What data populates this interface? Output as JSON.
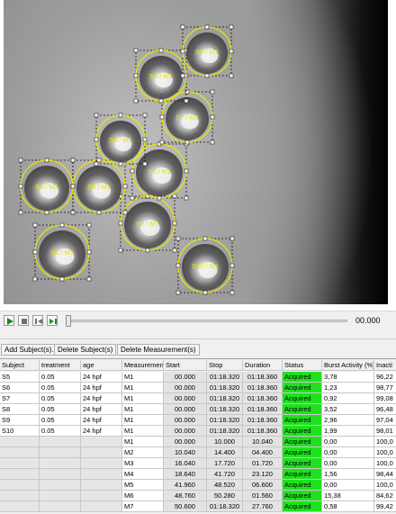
{
  "arena": {
    "regions": [
      {
        "label": "S1 / M1"
      },
      {
        "label": "S2 / M1"
      },
      {
        "label": "S3 / M1"
      },
      {
        "label": "S4 / M1"
      },
      {
        "label": "S5 / M1"
      },
      {
        "label": "S6 / M1"
      },
      {
        "label": "S7 / M1"
      },
      {
        "label": "S8 / M1"
      },
      {
        "label": "S9 / M1"
      },
      {
        "label": "S10 / M1"
      }
    ],
    "region_color": "#e8e800"
  },
  "player": {
    "time": "00.000",
    "progress": 0
  },
  "actions": {
    "add_subjects": "Add Subject(s)...",
    "delete_subjects": "Delete Subject(s)",
    "delete_measurement": "Delete Measurement(s)"
  },
  "table": {
    "columns": [
      "Subject",
      "treatment",
      "age",
      "Measurement",
      "Start",
      "Stop",
      "Duration",
      "Status",
      "Burst Activity (%)",
      "Inacti"
    ],
    "rows": [
      {
        "subject": "S5",
        "treatment": "0.05",
        "age": "24 hpf",
        "measurement": "M1",
        "start": "00.000",
        "stop": "01:18.320",
        "duration": "01:18.360",
        "status": "Acquired",
        "burst": "3,78",
        "inact": "96,22"
      },
      {
        "subject": "S6",
        "treatment": "0.05",
        "age": "24 hpf",
        "measurement": "M1",
        "start": "00.000",
        "stop": "01:18.320",
        "duration": "01:18.360",
        "status": "Acquired",
        "burst": "1,23",
        "inact": "98,77"
      },
      {
        "subject": "S7",
        "treatment": "0.05",
        "age": "24 hpf",
        "measurement": "M1",
        "start": "00.000",
        "stop": "01:18.320",
        "duration": "01:18.360",
        "status": "Acquired",
        "burst": "0,92",
        "inact": "99,08"
      },
      {
        "subject": "S8",
        "treatment": "0.05",
        "age": "24 hpf",
        "measurement": "M1",
        "start": "00.000",
        "stop": "01:18.320",
        "duration": "01:18.360",
        "status": "Acquired",
        "burst": "3,52",
        "inact": "96,48"
      },
      {
        "subject": "S9",
        "treatment": "0.05",
        "age": "24 hpf",
        "measurement": "M1",
        "start": "00.000",
        "stop": "01:18.320",
        "duration": "01:18.360",
        "status": "Acquired",
        "burst": "2,96",
        "inact": "97,04"
      },
      {
        "subject": "S10",
        "treatment": "0.05",
        "age": "24 hpf",
        "measurement": "M1",
        "start": "00.000",
        "stop": "01:18.320",
        "duration": "01:18.360",
        "status": "Acquired",
        "burst": "1,99",
        "inact": "98,01"
      },
      {
        "subject": "",
        "treatment": "",
        "age": "",
        "measurement": "M1",
        "start": "00.000",
        "stop": "10.000",
        "duration": "10.040",
        "status": "Acquired",
        "burst": "0,00",
        "inact": "100,0"
      },
      {
        "subject": "",
        "treatment": "",
        "age": "",
        "measurement": "M2",
        "start": "10.040",
        "stop": "14.400",
        "duration": "04.400",
        "status": "Acquired",
        "burst": "0,00",
        "inact": "100,0"
      },
      {
        "subject": "",
        "treatment": "",
        "age": "",
        "measurement": "M3",
        "start": "16.040",
        "stop": "17.720",
        "duration": "01.720",
        "status": "Acquired",
        "burst": "0,00",
        "inact": "100,0"
      },
      {
        "subject": "",
        "treatment": "",
        "age": "",
        "measurement": "M4",
        "start": "18.640",
        "stop": "41.720",
        "duration": "23.120",
        "status": "Acquired",
        "burst": "1,56",
        "inact": "98,44"
      },
      {
        "subject": "",
        "treatment": "",
        "age": "",
        "measurement": "M5",
        "start": "41.960",
        "stop": "48.520",
        "duration": "06.600",
        "status": "Acquired",
        "burst": "0,00",
        "inact": "100,0"
      },
      {
        "subject": "",
        "treatment": "",
        "age": "",
        "measurement": "M6",
        "start": "48.760",
        "stop": "50.280",
        "duration": "01.560",
        "status": "Acquired",
        "burst": "15,38",
        "inact": "84,62"
      },
      {
        "subject": "",
        "treatment": "",
        "age": "",
        "measurement": "M7",
        "start": "50.600",
        "stop": "01:18.320",
        "duration": "27.760",
        "status": "Acquired",
        "burst": "0,58",
        "inact": "99,42"
      }
    ]
  }
}
